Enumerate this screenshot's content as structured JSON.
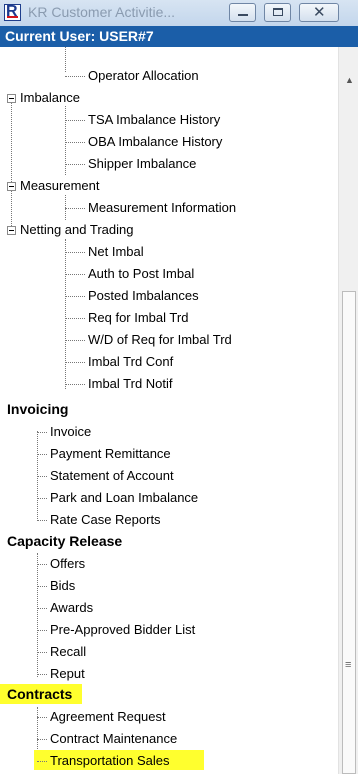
{
  "window": {
    "title": "KR Customer Activitie...",
    "current_user": "Current User: USER#7"
  },
  "tree": {
    "measurement_group": {
      "imbalance": "Imbalance",
      "tsa_imbalance_history": "TSA Imbalance History",
      "oba_imbalance_history": "OBA Imbalance History",
      "shipper_imbalance": "Shipper Imbalance",
      "measurement": "Measurement",
      "measurement_information": "Measurement Information",
      "netting_and_trading": "Netting and Trading",
      "net_imbal": "Net Imbal",
      "auth_to_post_imbal": "Auth to Post Imbal",
      "posted_imbalances": "Posted Imbalances",
      "req_for_imbal_trd": "Req for Imbal Trd",
      "wd_req_for_imbal_trd": "W/D of Req for Imbal Trd",
      "imbal_trd_conf": "Imbal Trd Conf",
      "imbal_trd_notif": "Imbal Trd Notif"
    },
    "operator_allocation": "Operator Allocation",
    "invoicing": {
      "title": "Invoicing",
      "items": [
        "Invoice",
        "Payment Remittance",
        "Statement of Account",
        "Park and Loan Imbalance",
        "Rate Case Reports"
      ]
    },
    "capacity_release": {
      "title": "Capacity Release",
      "items": [
        "Offers",
        "Bids",
        "Awards",
        "Pre-Approved Bidder List",
        "Recall",
        "Reput"
      ]
    },
    "contracts": {
      "title": "Contracts",
      "items": [
        "Agreement Request",
        "Contract Maintenance",
        "Transportation Sales"
      ]
    }
  },
  "colors": {
    "highlight": "#ffff2e",
    "user_bar": "#1b5ea8"
  }
}
